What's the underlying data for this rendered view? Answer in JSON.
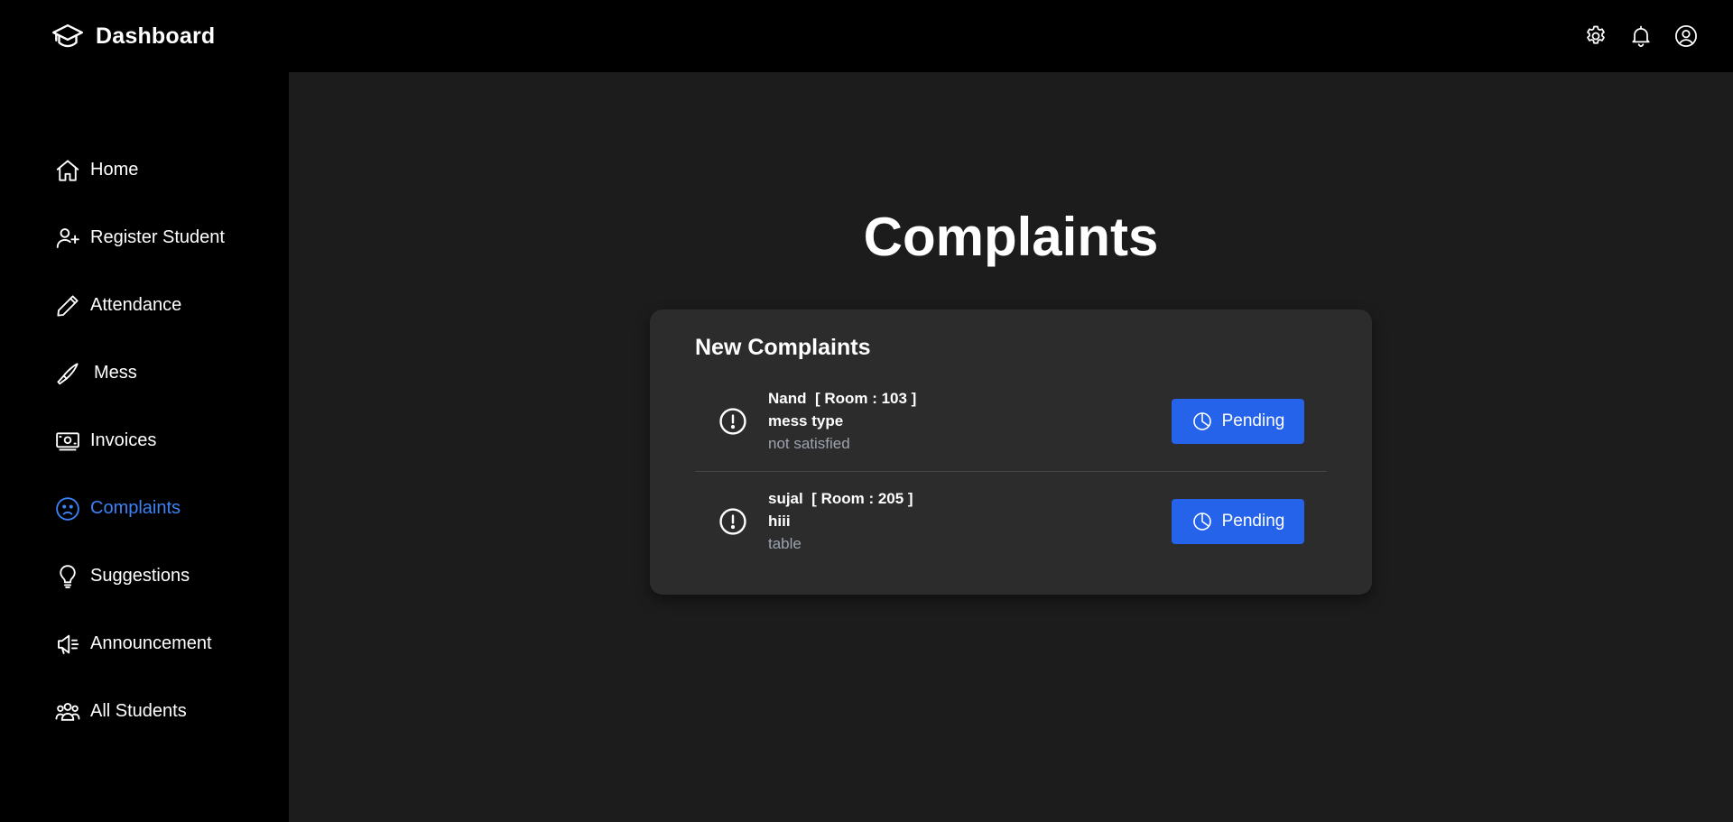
{
  "brand": {
    "title": "Dashboard",
    "icon": "graduation-cap-icon"
  },
  "topbar_icons": [
    "gear-icon",
    "bell-icon",
    "user-circle-icon"
  ],
  "sidebar": {
    "items": [
      {
        "label": "Home",
        "icon": "home-icon"
      },
      {
        "label": "Register Student",
        "icon": "user-plus-icon"
      },
      {
        "label": "Attendance",
        "icon": "pencil-icon"
      },
      {
        "label": "Mess",
        "icon": "knife-icon"
      },
      {
        "label": "Invoices",
        "icon": "banknote-icon"
      },
      {
        "label": "Complaints",
        "icon": "frown-face-icon",
        "active": true
      },
      {
        "label": "Suggestions",
        "icon": "lightbulb-icon"
      },
      {
        "label": "Announcement",
        "icon": "megaphone-icon"
      },
      {
        "label": "All Students",
        "icon": "users-icon"
      }
    ]
  },
  "main": {
    "title": "Complaints",
    "card": {
      "title": "New Complaints",
      "complaints": [
        {
          "header": "Nand  [ Room : 103 ]",
          "type": "mess type",
          "description": "not satisfied",
          "status": "Pending"
        },
        {
          "header": "sujal  [ Room : 205 ]",
          "type": "hiii",
          "description": "table",
          "status": "Pending"
        }
      ]
    }
  },
  "colors": {
    "accent": "#2563eb",
    "active_nav": "#3b82f6",
    "background": "#1c1c1c",
    "sidebar": "#000000",
    "card": "#2c2c2c",
    "muted_text": "#9ca3af"
  }
}
